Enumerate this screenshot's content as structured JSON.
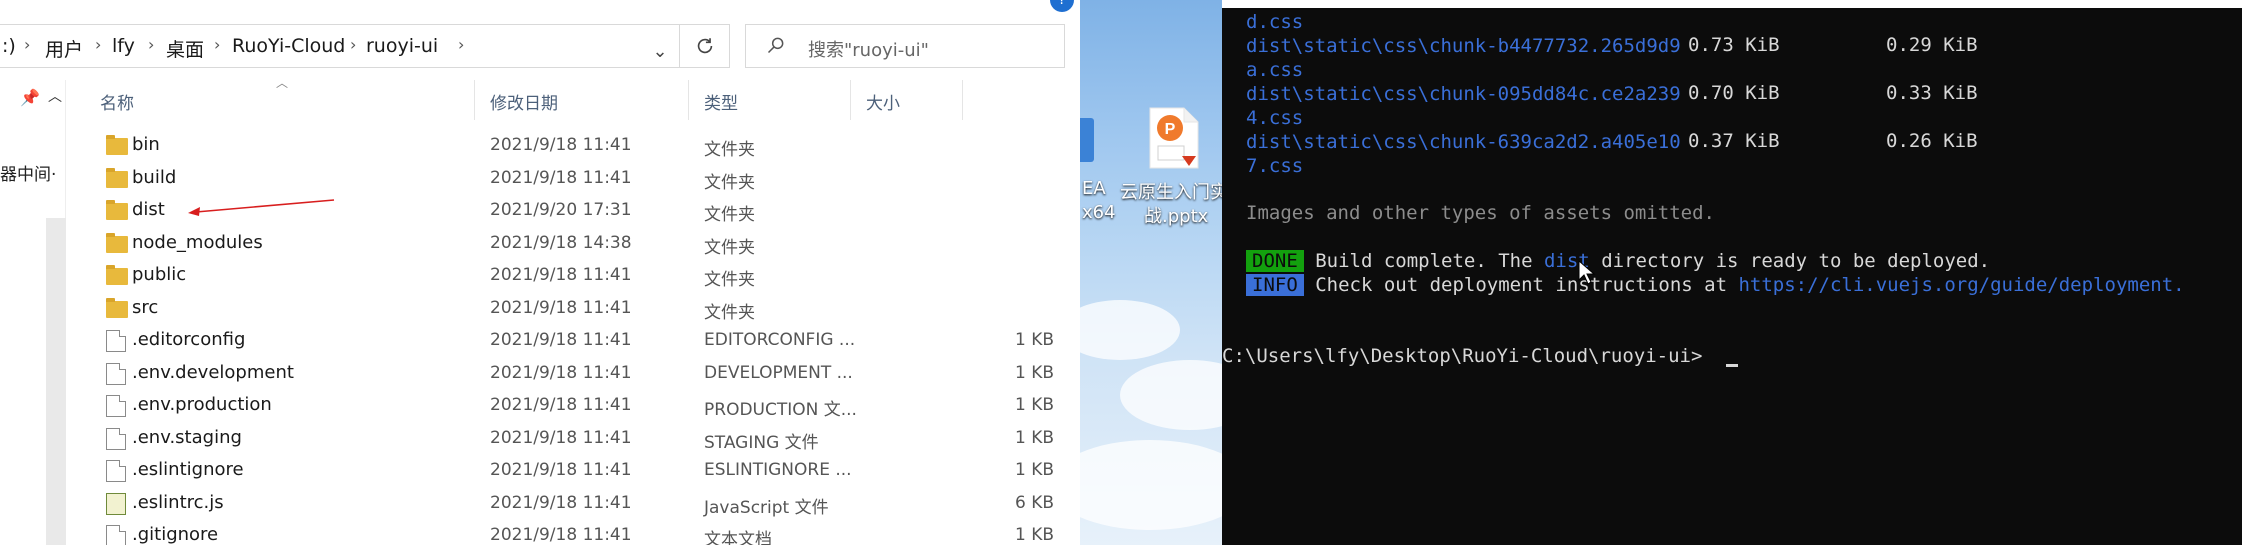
{
  "explorer": {
    "breadcrumb": [
      "用户",
      "lfy",
      "桌面",
      "RuoYi-Cloud",
      "ruoyi-ui"
    ],
    "breadcrumb_prefix": ":)",
    "search_placeholder": "搜索\"ruoyi-ui\"",
    "nav_label": "器中间·",
    "columns": {
      "name": "名称",
      "date": "修改日期",
      "type": "类型",
      "size": "大小"
    },
    "files": [
      {
        "name": "bin",
        "date": "2021/9/18 11:41",
        "type": "文件夹",
        "size": "",
        "icon": "folder-icon"
      },
      {
        "name": "build",
        "date": "2021/9/18 11:41",
        "type": "文件夹",
        "size": "",
        "icon": "folder-icon"
      },
      {
        "name": "dist",
        "date": "2021/9/20 17:31",
        "type": "文件夹",
        "size": "",
        "icon": "folder-icon"
      },
      {
        "name": "node_modules",
        "date": "2021/9/18 14:38",
        "type": "文件夹",
        "size": "",
        "icon": "folder-icon"
      },
      {
        "name": "public",
        "date": "2021/9/18 11:41",
        "type": "文件夹",
        "size": "",
        "icon": "folder-icon"
      },
      {
        "name": "src",
        "date": "2021/9/18 11:41",
        "type": "文件夹",
        "size": "",
        "icon": "folder-icon"
      },
      {
        "name": ".editorconfig",
        "date": "2021/9/18 11:41",
        "type": "EDITORCONFIG ...",
        "size": "1 KB",
        "icon": "file-icon"
      },
      {
        "name": ".env.development",
        "date": "2021/9/18 11:41",
        "type": "DEVELOPMENT ...",
        "size": "1 KB",
        "icon": "file-icon"
      },
      {
        "name": ".env.production",
        "date": "2021/9/18 11:41",
        "type": "PRODUCTION 文...",
        "size": "1 KB",
        "icon": "file-icon"
      },
      {
        "name": ".env.staging",
        "date": "2021/9/18 11:41",
        "type": "STAGING 文件",
        "size": "1 KB",
        "icon": "file-icon"
      },
      {
        "name": ".eslintignore",
        "date": "2021/9/18 11:41",
        "type": "ESLINTIGNORE ...",
        "size": "1 KB",
        "icon": "file-icon"
      },
      {
        "name": ".eslintrc.js",
        "date": "2021/9/18 11:41",
        "type": "JavaScript 文件",
        "size": "6 KB",
        "icon": "js-file-icon"
      },
      {
        "name": ".gitignore",
        "date": "2021/9/18 11:41",
        "type": "文本文档",
        "size": "1 KB",
        "icon": "file-icon"
      }
    ]
  },
  "desktop": {
    "idea_label_1": "EA",
    "idea_label_2": "x64",
    "ppt_label_1": "云原生入门实",
    "ppt_label_2": "战.pptx"
  },
  "terminal": {
    "lines": [
      {
        "text": "d.css",
        "color": "blue"
      },
      {
        "text": "dist\\static\\css\\chunk-b4477732.265d9d9",
        "color": "blue",
        "s1": "0.73 KiB",
        "s2": "0.29 KiB"
      },
      {
        "text": "a.css",
        "color": "blue"
      },
      {
        "text": "dist\\static\\css\\chunk-095dd84c.ce2a239",
        "color": "blue",
        "s1": "0.70 KiB",
        "s2": "0.33 KiB"
      },
      {
        "text": "4.css",
        "color": "blue"
      },
      {
        "text": "dist\\static\\css\\chunk-639ca2d2.a405e10",
        "color": "blue",
        "s1": "0.37 KiB",
        "s2": "0.26 KiB"
      },
      {
        "text": "7.css",
        "color": "blue"
      }
    ],
    "omitted": "Images and other types of assets omitted.",
    "done_tag": "DONE",
    "done_msg_a": " Build complete. The ",
    "done_msg_dist": "dist",
    "done_msg_b": " directory is ready to be deployed.",
    "info_tag": "INFO",
    "info_msg": " Check out deployment instructions at ",
    "info_url": "https://cli.vuejs.org/guide/deployment.",
    "prompt": "C:\\Users\\lfy\\Desktop\\RuoYi-Cloud\\ruoyi-ui>"
  },
  "colors": {
    "folder": "#e8b93c",
    "terminal_blue": "#3a6fd8",
    "done_green": "#13a10e",
    "arrow_red": "#d81e1e"
  }
}
